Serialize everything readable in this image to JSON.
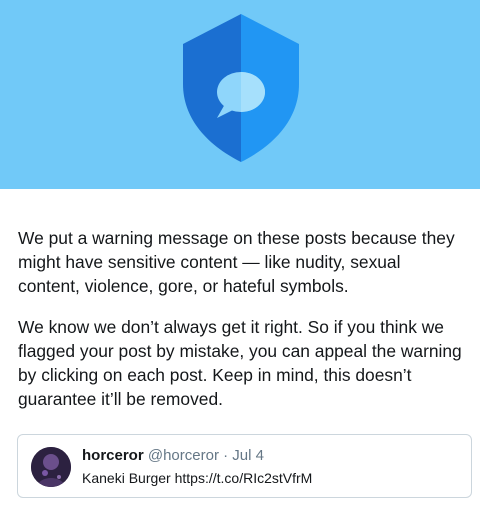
{
  "hero": {
    "background_color": "#71c9f8",
    "icon": "shield-speech-bubble-icon",
    "icon_colors": {
      "left": "#1b6fd1",
      "right": "#2196f3",
      "bubble": "#8fd6fb"
    }
  },
  "body": {
    "paragraph_1": "We put a warning message on these posts because they might have sensitive content — like nudity, sexual content, violence, gore, or hateful symbols.",
    "paragraph_2": "We know we don’t always get it right. So if you think we flagged your post by mistake, you can appeal the warning by clicking on each post. Keep in mind, this doesn’t guarantee it’ll be removed."
  },
  "tweet": {
    "name": "horceror",
    "handle": "@horceror",
    "separator": "·",
    "date": "Jul 4",
    "text": "Kaneki Burger https://t.co/RIc2stVfrM",
    "avatar_icon": "user-avatar"
  }
}
